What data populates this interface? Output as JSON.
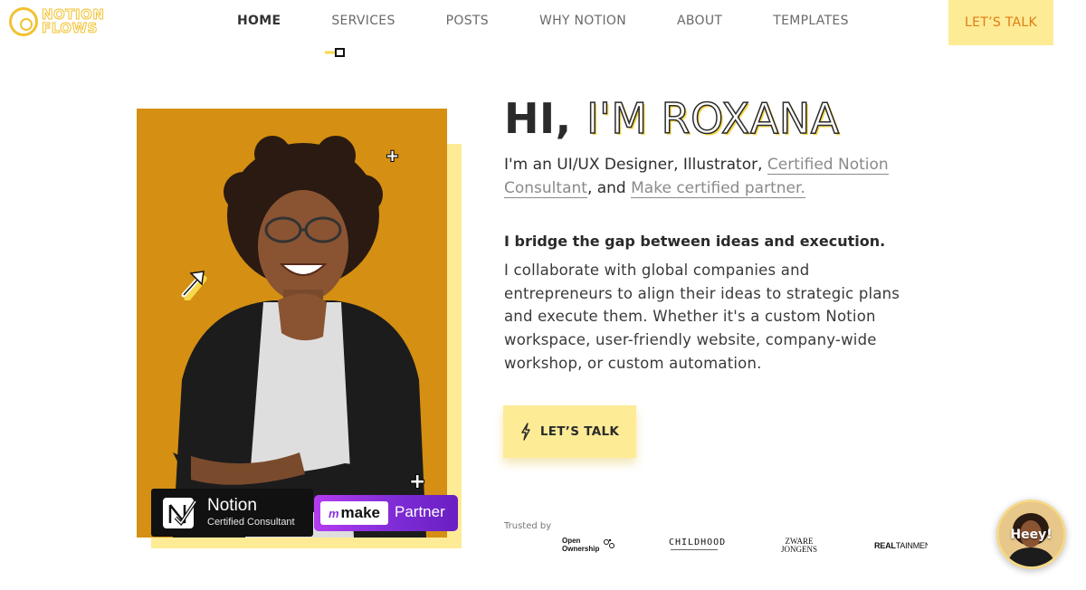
{
  "brand": {
    "line1": "NOTION",
    "line2": "FLOWS",
    "accent": "#f2c230"
  },
  "nav": {
    "items": [
      {
        "label": "HOME",
        "active": true
      },
      {
        "label": "SERVICES",
        "active": false
      },
      {
        "label": "POSTS",
        "active": false
      },
      {
        "label": "WHY NOTION",
        "active": false
      },
      {
        "label": "ABOUT",
        "active": false
      },
      {
        "label": "TEMPLATES",
        "active": false
      }
    ],
    "cta": "LET’S TALK"
  },
  "hero": {
    "greeting": "HI,",
    "name": "I'M ROXANA",
    "intro_prefix": "I'm an UI/UX Designer, Illustrator, ",
    "intro_link1": "Certified Notion Consultant",
    "intro_mid": ", and ",
    "intro_link2": "Make certified partner.",
    "bridge": "I bridge the gap between ideas and execution.",
    "body": "I collaborate with global companies and entrepreneurs to align their ideas to strategic plans and execute them. Whether it's a custom Notion workspace, user-friendly website, company-wide workshop, or custom automation.",
    "cta": "LET’S TALK",
    "cta_icon": "lightning-icon"
  },
  "badges": {
    "notion_title": "Notion",
    "notion_sub": "Certified Consultant",
    "make_glyph": "m",
    "make_word": "make",
    "make_partner": "Partner"
  },
  "trusted": {
    "label": "Trusted by",
    "logos": {
      "open_ownership_line1": "Open",
      "open_ownership_line2": "Ownership",
      "childhood": "CHILDHOOD",
      "zware_line1": "ZWARE",
      "zware_line2": "JONGENS",
      "realtainment_bold": "REAL",
      "realtainment_rest": "TAINMENT"
    }
  },
  "chat": {
    "label": "Heey!"
  },
  "colors": {
    "yellow_light": "#fdeb96",
    "photo_bg": "#d58f12",
    "nav_cta_text": "#e07d10",
    "make_purple": "#7c2bd4"
  }
}
